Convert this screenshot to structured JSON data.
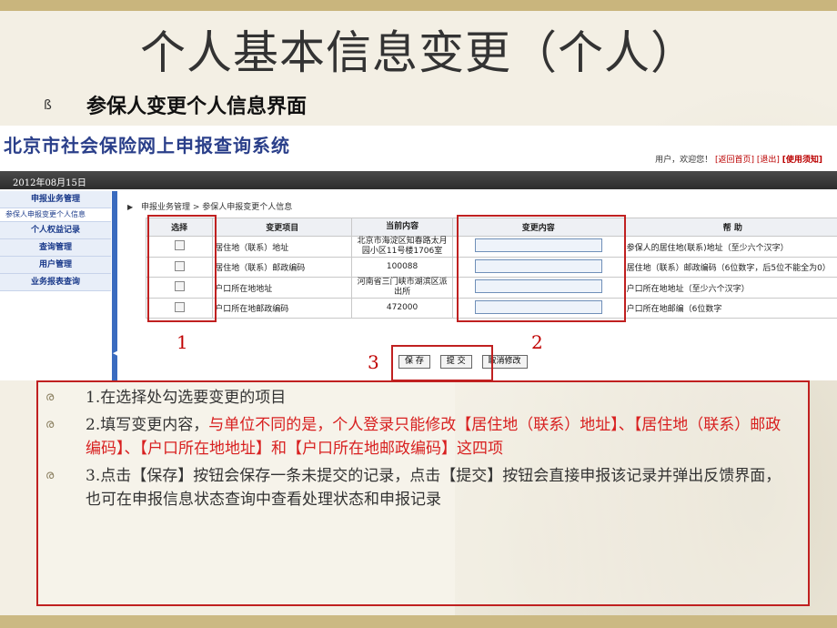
{
  "slide": {
    "title": "个人基本信息变更（个人）",
    "bullet_glyph": "ß",
    "subtitle": "参保人变更个人信息界面"
  },
  "app": {
    "logo": "北京市社会保险网上申报查询系统",
    "user_greeting": "用户，欢迎您！",
    "links": [
      "[返回首页]",
      "[退出]",
      "[使用须知]"
    ],
    "date": "2012年08月15日",
    "sidebar": {
      "items": [
        "申报业务管理",
        "参保人申报变更个人信息",
        "个人权益记录",
        "查询管理",
        "用户管理",
        "业务报表查询"
      ]
    },
    "breadcrumb": "申报业务管理 > 参保人申报变更个人信息",
    "table": {
      "headers": [
        "选择",
        "变更项目",
        "当前内容",
        "变更内容",
        "帮 助"
      ],
      "rows": [
        {
          "item": "居住地（联系）地址",
          "current": "北京市海淀区知春路太月园小区11号楼1706室",
          "help": "参保人的居住地(联系)地址（至少六个汉字）"
        },
        {
          "item": "居住地（联系）邮政编码",
          "current": "100088",
          "help": "居住地（联系）邮政编码（6位数字，后5位不能全为0）"
        },
        {
          "item": "户口所在地地址",
          "current": "河南省三门峡市湖滨区派出所",
          "help": "户口所在地地址（至少六个汉字）"
        },
        {
          "item": "户口所在地邮政编码",
          "current": "472000",
          "help": "户口所在地邮编（6位数字"
        }
      ]
    },
    "buttons": {
      "save": "保 存",
      "submit": "提 交",
      "cancel": "取消修改"
    }
  },
  "callouts": {
    "n1": "1",
    "n2": "2",
    "n3": "3"
  },
  "notes": {
    "glyph": "ര",
    "n1": "1.在选择处勾选要变更的项目",
    "n2_a": "2.填写变更内容，",
    "n2_b": "与单位不同的是，个人登录只能修改【居住地（联系）地址】、【居住地（联系）邮政编码】、【户口所在地地址】和【户口所在地邮政编码】这四项",
    "n3": "3.点击【保存】按钮会保存一条未提交的记录，点击【提交】按钮会直接申报该记录并弹出反馈界面，也可在申报信息状态查询中查看处理状态和申报记录"
  },
  "colors": {
    "accent_red": "#c02020",
    "note_red": "#d82020",
    "logo_blue": "#2a3f8a",
    "gold_band": "#c9b57d"
  }
}
